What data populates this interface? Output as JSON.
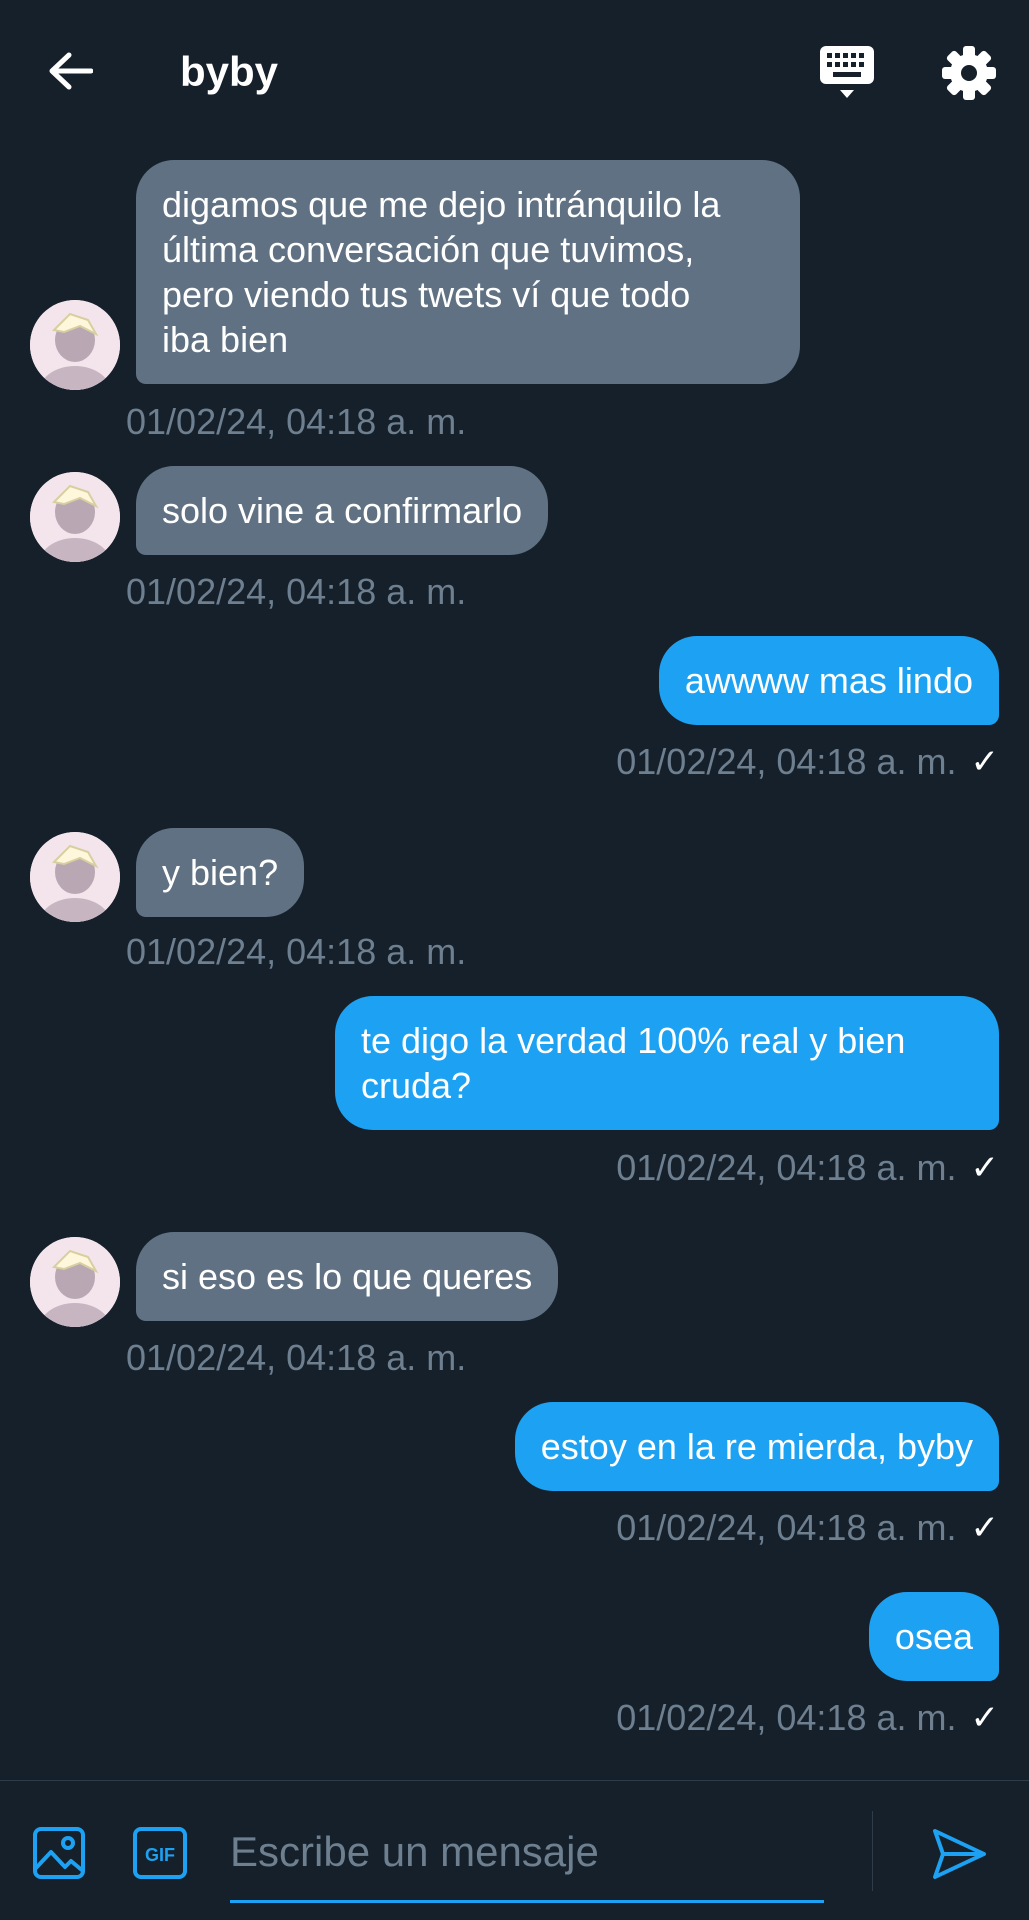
{
  "header": {
    "title": "byby",
    "back_icon": "arrow-left-icon",
    "keyboard_icon": "keyboard-icon",
    "settings_icon": "gear-icon"
  },
  "messages": [
    {
      "direction": "received",
      "lines": [
        "digamos que me dejo intránquilo la",
        "última conversación que tuvimos,",
        "pero viendo tus twets ví que todo",
        "iba bien"
      ],
      "timestamp": "01/02/24, 04:18 a. m."
    },
    {
      "direction": "received",
      "lines": [
        "solo vine a confirmarlo"
      ],
      "timestamp": "01/02/24, 04:18 a. m."
    },
    {
      "direction": "sent",
      "lines": [
        "awwww mas lindo"
      ],
      "timestamp": "01/02/24, 04:18 a. m.",
      "read": "✓"
    },
    {
      "direction": "received",
      "lines": [
        "y bien?"
      ],
      "timestamp": "01/02/24, 04:18 a. m."
    },
    {
      "direction": "sent",
      "lines": [
        "te digo la verdad 100% real y bien",
        "cruda?"
      ],
      "timestamp": "01/02/24, 04:18 a. m.",
      "read": "✓"
    },
    {
      "direction": "received",
      "lines": [
        "si eso es lo que queres"
      ],
      "timestamp": "01/02/24, 04:18 a. m."
    },
    {
      "direction": "sent",
      "lines": [
        "estoy en la re mierda, byby"
      ],
      "timestamp": "01/02/24, 04:18 a. m.",
      "read": "✓"
    },
    {
      "direction": "sent",
      "lines": [
        "osea"
      ],
      "timestamp": "01/02/24, 04:18 a. m.",
      "read": "✓"
    }
  ],
  "composer": {
    "placeholder": "Escribe un mensaje",
    "image_icon": "image-icon",
    "gif_label": "GIF",
    "send_icon": "send-icon"
  },
  "colors": {
    "background": "#15202b",
    "sent_bubble": "#1da1f2",
    "received_bubble": "#5f7182",
    "timestamp": "#6e7f8f"
  }
}
